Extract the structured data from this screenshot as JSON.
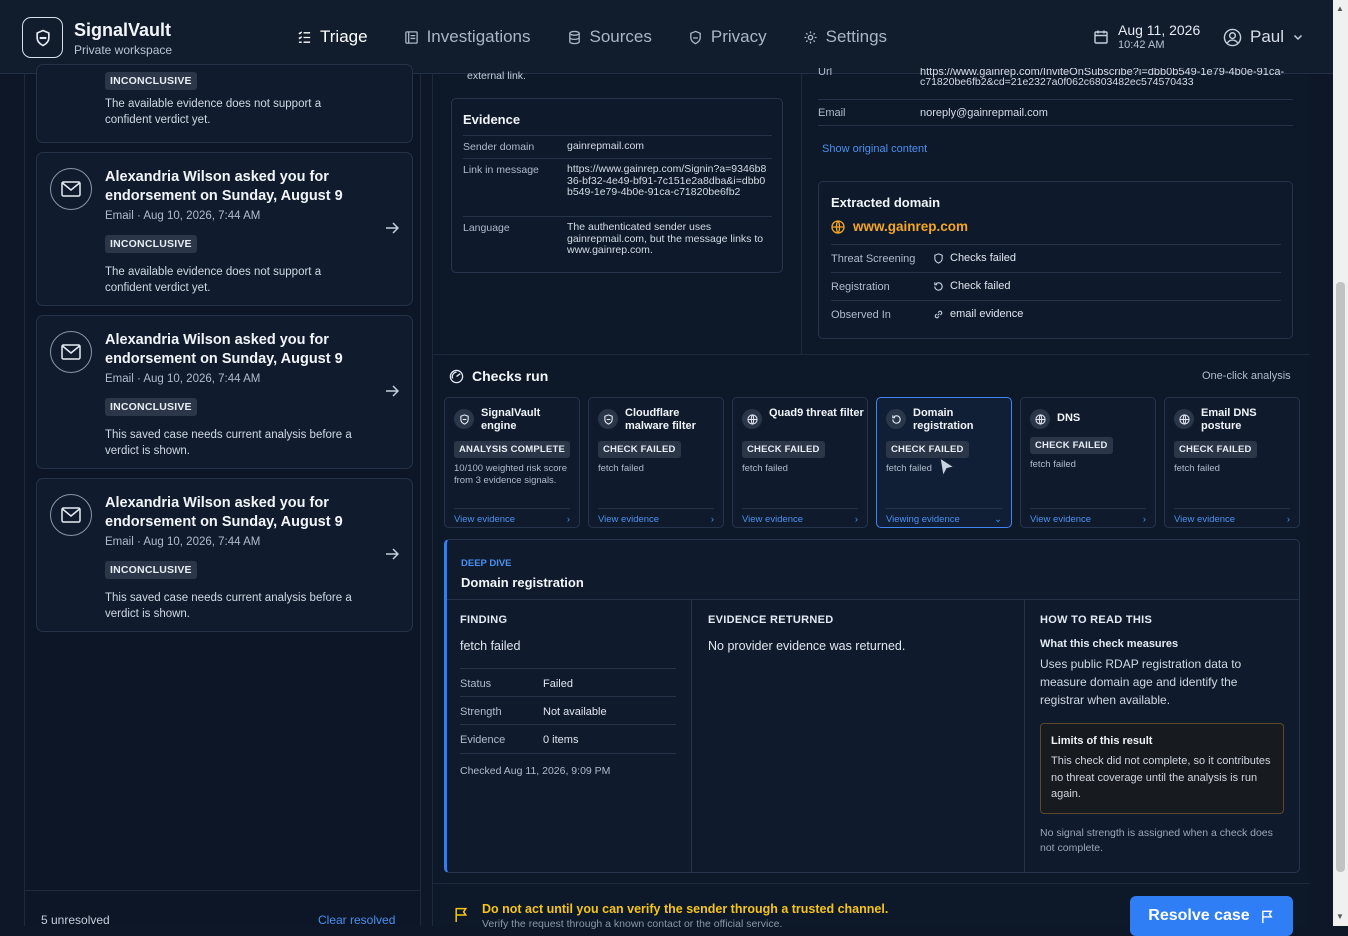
{
  "app": {
    "name": "SignalVault",
    "subtitle": "Private workspace"
  },
  "nav": [
    {
      "label": "Triage",
      "icon": "triage-icon"
    },
    {
      "label": "Investigations",
      "icon": "investigations-icon"
    },
    {
      "label": "Sources",
      "icon": "database-icon"
    },
    {
      "label": "Privacy",
      "icon": "shield-icon"
    },
    {
      "label": "Settings",
      "icon": "gear-icon"
    }
  ],
  "header": {
    "date": "Aug 11, 2026",
    "time": "10:42 AM",
    "user": "Paul"
  },
  "sidebar": {
    "cards": [
      {
        "badge": "INCONCLUSIVE",
        "desc": "The available evidence does not support a confident verdict yet."
      },
      {
        "title": "Alexandria Wilson asked you for endorsement on Sunday, August 9",
        "meta": "Email · Aug 10, 2026, 7:44 AM",
        "badge": "INCONCLUSIVE",
        "desc": "The available evidence does not support a confident verdict yet."
      },
      {
        "title": "Alexandria Wilson asked you for endorsement on Sunday, August 9",
        "meta": "Email · Aug 10, 2026, 7:44 AM",
        "badge": "INCONCLUSIVE",
        "desc": "This saved case needs current analysis before a verdict is shown."
      },
      {
        "title": "Alexandria Wilson asked you for endorsement on Sunday, August 9",
        "meta": "Email · Aug 10, 2026, 7:44 AM",
        "badge": "INCONCLUSIVE",
        "desc": "This saved case needs current analysis before a verdict is shown."
      }
    ],
    "unresolved": "5 unresolved",
    "clear": "Clear resolved"
  },
  "main": {
    "top_fragment": "external link.",
    "evidence": {
      "title": "Evidence",
      "rows": [
        {
          "k": "Sender domain",
          "v": "gainrepmail.com"
        },
        {
          "k": "Link in message",
          "v": "https://www.gainrep.com/Signin?a=9346b836-bf32-4e49-bf91-7c151e2a8dba&i=dbb0b549-1e79-4b0e-91ca-c71820be6fb2"
        },
        {
          "k": "Language",
          "v": "The authenticated sender uses gainrepmail.com, but the message links to www.gainrep.com."
        }
      ]
    },
    "right": {
      "url_key": "Url",
      "url_partial": "https://www.gainrep.com/InviteOnSubscribe?i=dbb0b549-1e79-4b0e-91ca-",
      "url_tail": "c71820be6fb2&cd=21e2327a0f062c6803482ec574570433",
      "email_key": "Email",
      "email_val": "noreply@gainrepmail.com",
      "show_original": "Show original content"
    },
    "extracted": {
      "title": "Extracted domain",
      "domain": "www.gainrep.com",
      "rows": [
        {
          "k": "Threat Screening",
          "v": "Checks failed",
          "icon": "shield-icon"
        },
        {
          "k": "Registration",
          "v": "Check failed",
          "icon": "refresh-icon"
        },
        {
          "k": "Observed In",
          "v": "email evidence",
          "icon": "link-icon"
        }
      ]
    },
    "checks_title": "Checks run",
    "one_click": "One-click analysis",
    "checks": [
      {
        "name": "SignalVault engine",
        "badge": "ANALYSIS COMPLETE",
        "note": "10/100 weighted risk score from 3 evidence signals.",
        "link": "View evidence",
        "icon": "shield-icon"
      },
      {
        "name": "Cloudflare malware filter",
        "badge": "CHECK FAILED",
        "note": "fetch failed",
        "link": "View evidence",
        "icon": "shield-icon"
      },
      {
        "name": "Quad9 threat filter",
        "badge": "CHECK FAILED",
        "note": "fetch failed",
        "link": "View evidence",
        "icon": "globe-icon"
      },
      {
        "name": "Domain registration",
        "badge": "CHECK FAILED",
        "note": "fetch failed",
        "link": "Viewing evidence",
        "icon": "refresh-icon"
      },
      {
        "name": "DNS",
        "badge": "CHECK FAILED",
        "note": "fetch failed",
        "link": "View evidence",
        "icon": "globe-icon"
      },
      {
        "name": "Email DNS posture",
        "badge": "CHECK FAILED",
        "note": "fetch failed",
        "link": "View evidence",
        "icon": "globe-icon"
      }
    ],
    "deep_dive": {
      "label": "DEEP DIVE",
      "title": "Domain registration",
      "finding_h": "FINDING",
      "finding": "fetch failed",
      "rows": [
        {
          "k": "Status",
          "v": "Failed"
        },
        {
          "k": "Strength",
          "v": "Not available"
        },
        {
          "k": "Evidence",
          "v": "0 items"
        }
      ],
      "checked": "Checked Aug 11, 2026, 9:09 PM",
      "ev_h": "EVIDENCE RETURNED",
      "ev": "No provider evidence was returned.",
      "how_h": "HOW TO READ THIS",
      "how_q": "What this check measures",
      "how_a": "Uses public RDAP registration data to measure domain age and identify the registrar when available.",
      "limits_h": "Limits of this result",
      "limits_t": "This check did not complete, so it contributes no threat coverage until the analysis is run again.",
      "nosig": "No signal strength is assigned when a check does not complete."
    },
    "warning": "Do not act until you can verify the sender through a trusted channel.",
    "warning_sub": "Verify the request through a known contact or the official service.",
    "resolve": "Resolve case"
  },
  "colors": {
    "accent": "#2f7ef5",
    "warning": "#f5c518",
    "domain": "#f5a623"
  }
}
